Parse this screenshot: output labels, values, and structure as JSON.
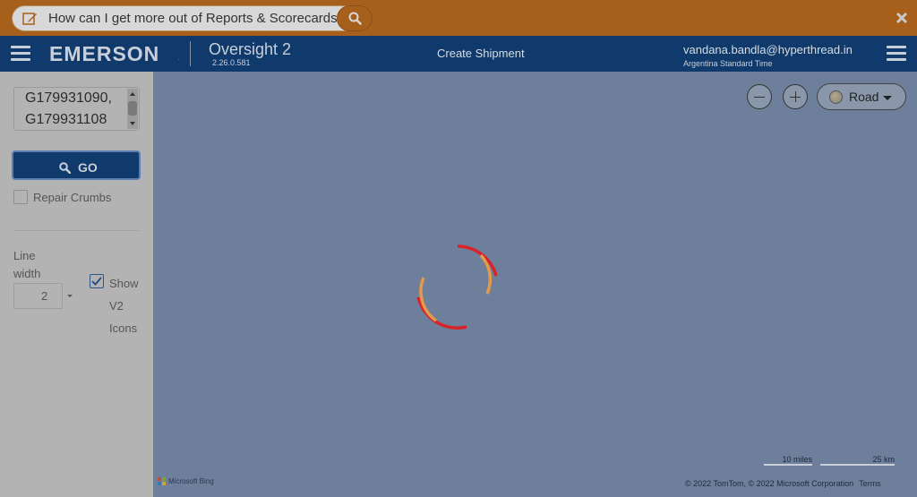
{
  "help": {
    "question": "How can I get more out of Reports & Scorecards?"
  },
  "header": {
    "brand": "EMERSON",
    "brand_tm": ".",
    "app_name": "Oversight 2",
    "app_version": "2.26.0.581",
    "page_title": "Create Shipment",
    "user_email": "vandana.bandla@hyperthread.in",
    "user_timezone": "Argentina Standard Time"
  },
  "sidebar": {
    "shipment_ids": [
      "G179931090,",
      "G179931108"
    ],
    "go_label": "GO",
    "repair_crumbs_label": "Repair Crumbs",
    "repair_crumbs_checked": false,
    "line_width_label": "Line width",
    "line_width_value": "2",
    "show_v2_icons_label": "Show V2 Icons",
    "show_v2_icons_checked": true
  },
  "map": {
    "style_label": "Road",
    "scale_miles": "10 miles",
    "scale_km": "25 km",
    "attribution_logo": "Microsoft Bing",
    "copyright": "© 2022 TomTom, © 2022 Microsoft Corporation",
    "terms": "Terms"
  },
  "colors": {
    "help_bar": "#a6601c",
    "header": "#0f3a6b",
    "spinner_red": "#d8232a",
    "spinner_orange": "#e59a4a"
  }
}
